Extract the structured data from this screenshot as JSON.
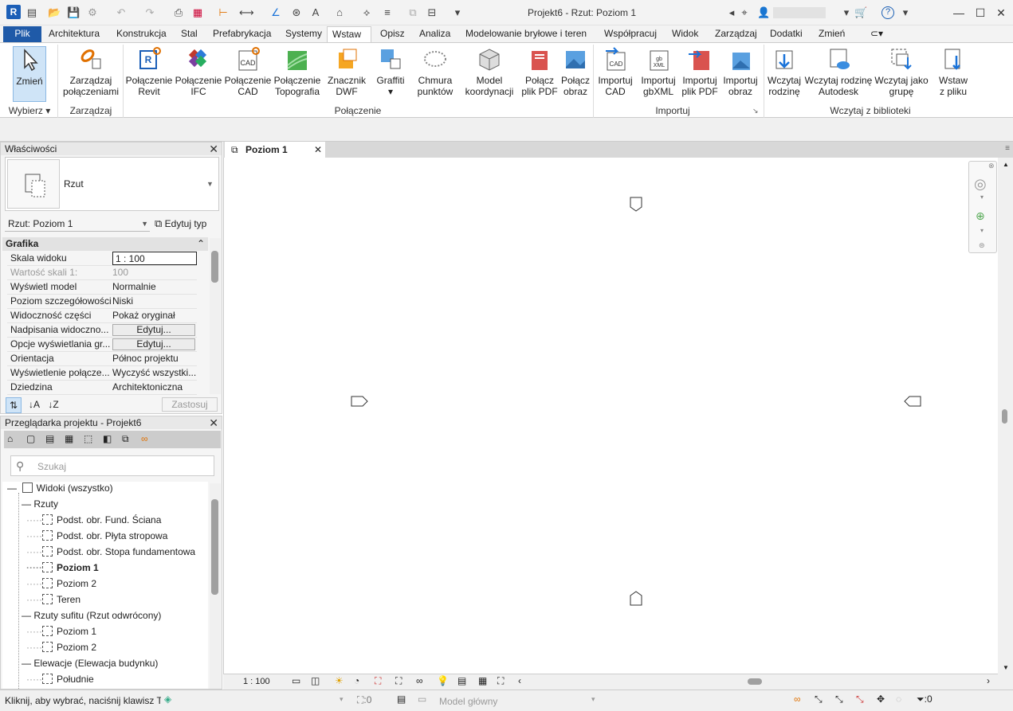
{
  "window": {
    "title": "Projekt6 - Rzut: Poziom 1",
    "app_icon": "R"
  },
  "tabs": [
    "Architektura",
    "Konstrukcja",
    "Stal",
    "Prefabrykacja",
    "Systemy",
    "Wstaw",
    "Opisz",
    "Analiza",
    "Modelowanie bryłowe i teren",
    "Współpracuj",
    "Widok",
    "Zarządzaj",
    "Dodatki",
    "Zmień"
  ],
  "file_tab": "Plik",
  "active_tab": "Wstaw",
  "ribbon": {
    "select": {
      "label": "Zmień",
      "group": "Wybierz"
    },
    "manage_links": {
      "label1": "Zarządzaj",
      "label2": "połączeniami",
      "group": "Zarządzaj"
    },
    "link_buttons": [
      [
        "Połączenie",
        "Revit"
      ],
      [
        "Połączenie",
        "IFC"
      ],
      [
        "Połączenie",
        "CAD"
      ],
      [
        "Połączenie",
        "Topografia"
      ],
      [
        "Znacznik",
        "DWF"
      ],
      [
        "Graffiti",
        ""
      ],
      [
        "Chmura",
        "punktów"
      ],
      [
        "Model",
        "koordynacji"
      ],
      [
        "Połącz",
        "plik PDF"
      ],
      [
        "Połącz",
        "obraz"
      ]
    ],
    "link_group": "Połączenie",
    "import_buttons": [
      [
        "Importuj",
        "CAD"
      ],
      [
        "Importuj",
        "gbXML"
      ],
      [
        "Importuj",
        "plik PDF"
      ],
      [
        "Importuj",
        "obraz"
      ]
    ],
    "import_group": "Importuj",
    "load_buttons": [
      [
        "Wczytaj",
        "rodzinę"
      ],
      [
        "Wczytaj rodzinę",
        "Autodesk"
      ],
      [
        "Wczytaj jako",
        "grupę"
      ],
      [
        "Wstaw",
        "z pliku"
      ]
    ],
    "load_group": "Wczytaj z biblioteki"
  },
  "properties": {
    "title": "Właściwości",
    "type_name": "Rzut",
    "selector": "Rzut: Poziom 1",
    "edit_type": "Edytuj typ",
    "section": "Grafika",
    "rows": [
      {
        "k": "Skala widoku",
        "v": "1 : 100"
      },
      {
        "k": "Wartość skali    1:",
        "v": "100"
      },
      {
        "k": "Wyświetl model",
        "v": "Normalnie"
      },
      {
        "k": "Poziom szczegółowości",
        "v": "Niski"
      },
      {
        "k": "Widoczność części",
        "v": "Pokaż oryginał"
      },
      {
        "k": "Nadpisania widoczno...",
        "v": "Edytuj..."
      },
      {
        "k": "Opcje wyświetlania gr...",
        "v": "Edytuj..."
      },
      {
        "k": "Orientacja",
        "v": "Północ projektu"
      },
      {
        "k": "Wyświetlenie połącze...",
        "v": "Wyczyść wszystki..."
      },
      {
        "k": "Dziedzina",
        "v": "Architektoniczna"
      }
    ],
    "apply": "Zastosuj"
  },
  "browser": {
    "title": "Przeglądarka projektu - Projekt6",
    "search_placeholder": "Szukaj",
    "root": "Widoki (wszystko)",
    "plans": "Rzuty",
    "plan_items": [
      "Podst. obr. Fund. Ściana",
      "Podst. obr. Płyta stropowa",
      "Podst. obr. Stopa fundamentowa",
      "Poziom 1",
      "Poziom 2",
      "Teren"
    ],
    "ceiling": "Rzuty sufitu (Rzut odwrócony)",
    "ceiling_items": [
      "Poziom 1",
      "Poziom 2"
    ],
    "elev": "Elewacje (Elewacja budynku)",
    "elev_items": [
      "Południe"
    ]
  },
  "view_tab": "Poziom 1",
  "view_scale": "1 : 100",
  "status": {
    "hint": "Kliknij, aby wybrać, naciśnij klawisz TA",
    "count": ":0",
    "model": "Model główny",
    "filter": ":0"
  }
}
